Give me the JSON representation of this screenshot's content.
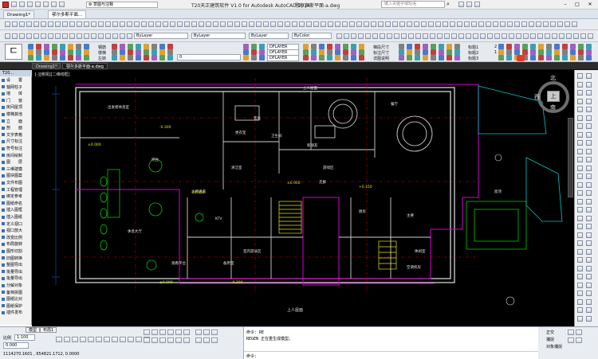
{
  "window": {
    "title": "T20天正建筑软件 V1.0 for Autodesk AutoCAD 2014",
    "file": "鄂尔多斯平面-a.dwg",
    "workspace": "草图与注释",
    "search_placeholder": "键入关键字或短语"
  },
  "doc_tabs": [
    "Drawing1*",
    "鄂尔多斯平面..."
  ],
  "layer_toolbar": {
    "layer_combo": "ByLayer",
    "linetype_combo": "ByLayer",
    "lineweight_combo": "ByLayer",
    "color_combo": "ByColor"
  },
  "ribbon": {
    "layer_value": "0",
    "dim_style_1": "DFLAYER",
    "dim_style_2": "DFLAYER",
    "dim_style_3": "DFLAYER",
    "label_a": "钢筋",
    "label_b": "楼梯",
    "label_c": "左转",
    "label_d": "梯段尺寸",
    "label_e": "标注尺寸",
    "label_f": "详图说明",
    "mini_labels": [
      "标题1",
      "标题2",
      "标题3"
    ],
    "num_values": [
      "2",
      "1"
    ]
  },
  "file_tabs": [
    {
      "label": "Drawing1*"
    },
    {
      "label": "鄂尔多斯平面-a.dwg",
      "active": true
    }
  ],
  "viewport_label": "[-][俯视][二维线框]",
  "tpanel": {
    "header": "T20...",
    "items": [
      "设　　置",
      "轴网柱子",
      "墙　　体",
      "门　　窗",
      "房间屋顶",
      "楼梯其他",
      "立　　面",
      "剖　　面",
      "文字表格",
      "尺寸标注",
      "符号标注",
      "房间绘制",
      "图　　层",
      "三维建模",
      "图块图案",
      "文件布图",
      "工程管理",
      "绑定参考",
      "图纸命名",
      "插入图框",
      "插入图纸",
      "定义视口",
      "视口放大",
      "改变比例",
      "布局旋转",
      "图形切割",
      "旧图转换",
      "整图导出",
      "批量导出",
      "批量导出",
      "分解对象",
      "备档拆图",
      "图纸比对",
      "图纸保护",
      "插件发布"
    ]
  },
  "compass": {
    "north": "北",
    "center": "上",
    "west": "西",
    "south": "南"
  },
  "drawing": {
    "rooms": [
      "出发者休息室",
      "客房",
      "更衣室",
      "清洁室",
      "卫生间",
      "新朋友",
      "餐厅",
      "主要通道",
      "吧台",
      "休息大厅",
      "观看平台",
      "游戏区",
      "KTV",
      "室内游泳区",
      "休闲室",
      "厨房",
      "屋顶",
      "备用室",
      "空调机房",
      "主要",
      "上人屋面",
      "走廊"
    ],
    "elevations": [
      "±0.000",
      "-0.300",
      "+0.150",
      "±0.000",
      "-0.300",
      "+0.150",
      "±0.000"
    ],
    "title_text": "上人屋面"
  },
  "bottom": {
    "tab_model": "模型",
    "tab_layout": "布局1",
    "scale_label": "比例",
    "scale_value": "1:100",
    "coords": "1114270.1601 , 654821.1712, 0.0000",
    "zoom_label": "0.000",
    "ortho_on": "正交",
    "snap": "捕捉",
    "object_snap": "对象捕捉",
    "cmd_line_1": "命令: RE",
    "cmd_line_2": "REGEN 正在重生成模型。",
    "cmd_prompt": "命令:"
  },
  "colors": {
    "canvas": "#000000",
    "wall": "#e4e4e4",
    "magenta": "#d400d4",
    "green": "#00c800",
    "yellow": "#e6e600",
    "cyan": "#00c8c8",
    "red": "#d40000",
    "blue": "#2050d0"
  },
  "icons": {
    "title_app": "t20-app-icon",
    "gear": "gear-icon",
    "search": "search-icon",
    "minimize": "minimize-icon",
    "maximize": "maximize-icon",
    "close": "close-icon",
    "compass": "viewcube-icon"
  }
}
